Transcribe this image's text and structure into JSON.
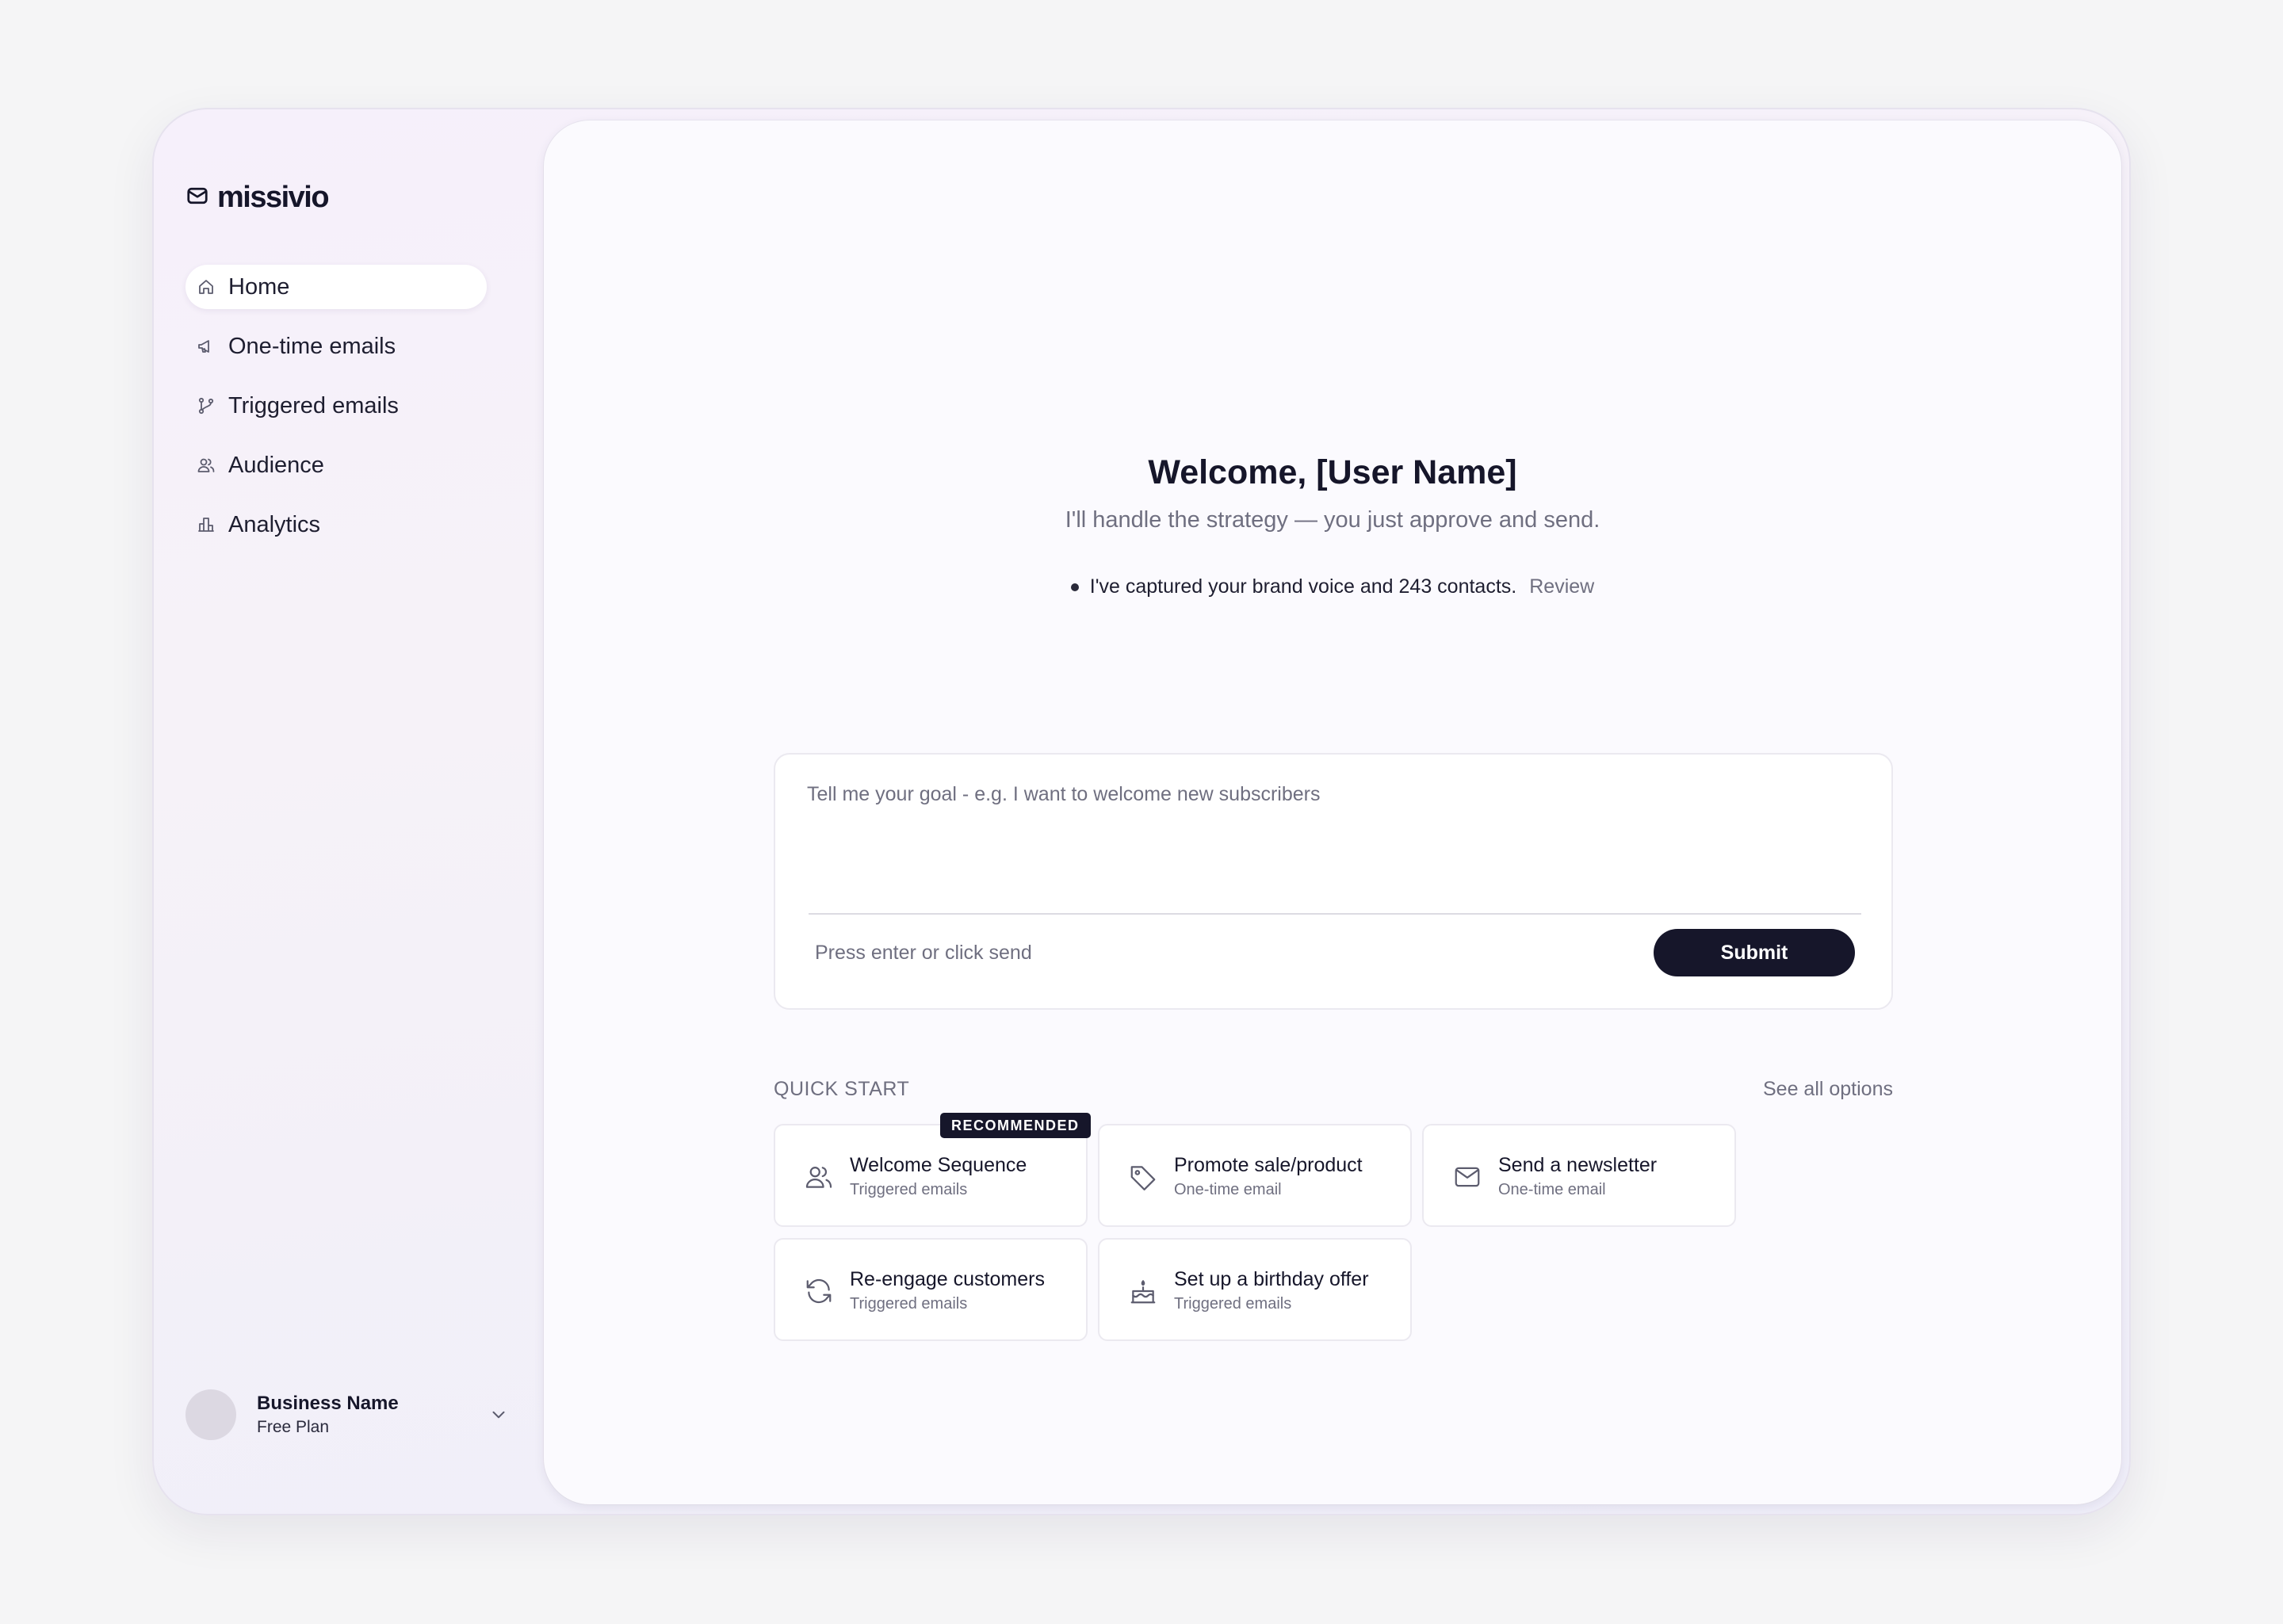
{
  "app": {
    "logo_text": "missivio"
  },
  "sidebar": {
    "items": [
      {
        "label": "Home",
        "icon": "home-icon",
        "active": true
      },
      {
        "label": "One-time emails",
        "icon": "megaphone-icon",
        "active": false
      },
      {
        "label": "Triggered emails",
        "icon": "branch-icon",
        "active": false
      },
      {
        "label": "Audience",
        "icon": "users-icon",
        "active": false
      },
      {
        "label": "Analytics",
        "icon": "bar-chart-icon",
        "active": false
      }
    ],
    "account": {
      "name": "Business Name",
      "plan": "Free Plan"
    }
  },
  "main": {
    "welcome": "Welcome, [User Name]",
    "subtitle": "I'll handle the strategy — you just approve and send.",
    "status_text": "I've captured your brand voice and 243 contacts.",
    "review_label": "Review",
    "composer": {
      "placeholder": "Tell me your goal - e.g. I want to welcome new subscribers",
      "value": "",
      "hint": "Press enter or click send",
      "submit_label": "Submit"
    },
    "quick_start": {
      "label": "QUICK START",
      "see_all": "See all options",
      "cards": [
        {
          "title": "Welcome Sequence",
          "subtitle": "Triggered emails",
          "icon": "users-icon",
          "badge": "RECOMMENDED"
        },
        {
          "title": "Promote sale/product",
          "subtitle": "One-time email",
          "icon": "tag-icon"
        },
        {
          "title": "Send a newsletter",
          "subtitle": "One-time email",
          "icon": "mail-icon"
        },
        {
          "title": "Re-engage customers",
          "subtitle": "Triggered emails",
          "icon": "refresh-icon"
        },
        {
          "title": "Set up a birthday offer",
          "subtitle": "Triggered emails",
          "icon": "cake-icon"
        }
      ]
    }
  },
  "colors": {
    "primary": "#16162a",
    "muted_text": "#6f6f80",
    "panel": "#fbfafe",
    "border": "#ebe9f0"
  }
}
